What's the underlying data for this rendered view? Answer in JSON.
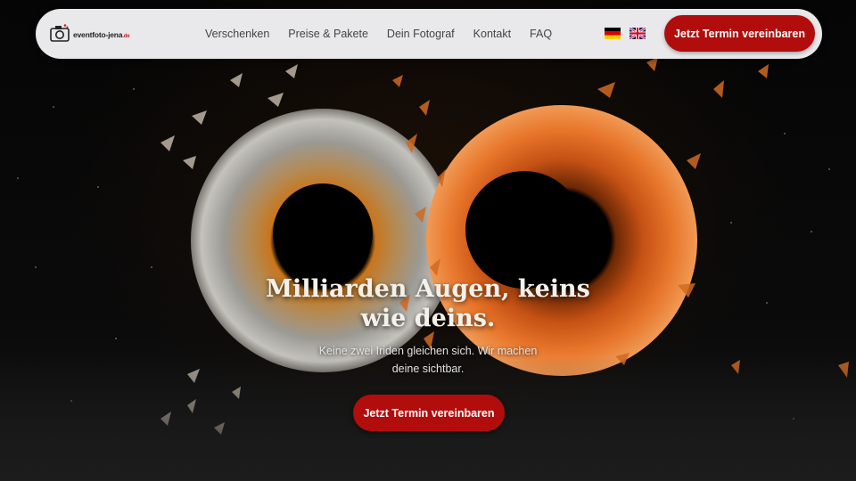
{
  "brand": {
    "logo_text": "eventfoto-jena",
    "logo_tld": ".de",
    "accent": "#b10d0d"
  },
  "nav": {
    "items": [
      {
        "label": "Verschenken"
      },
      {
        "label": "Preise & Pakete"
      },
      {
        "label": "Dein Fotograf"
      },
      {
        "label": "Kontakt"
      },
      {
        "label": "FAQ"
      }
    ],
    "languages": [
      "de",
      "en"
    ],
    "cta_label": "Jetzt Termin vereinbaren"
  },
  "hero": {
    "headline_line1": "Milliarden Augen, keins",
    "headline_line2": "wie deins.",
    "subtext_line1": "Keine zwei Iriden gleichen sich. Wir machen",
    "subtext_line2": "deine sichtbar.",
    "cta_label": "Jetzt Termin vereinbaren",
    "image": "two-irises-shattering"
  }
}
